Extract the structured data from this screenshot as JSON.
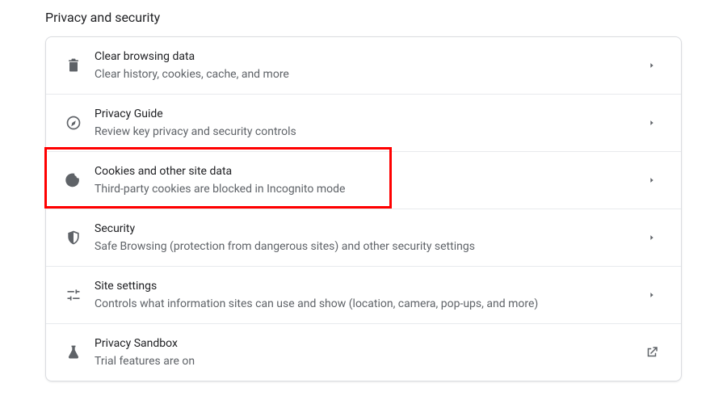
{
  "section_title": "Privacy and security",
  "items": [
    {
      "title": "Clear browsing data",
      "subtitle": "Clear history, cookies, cache, and more",
      "icon": "trash-icon",
      "action": "arrow"
    },
    {
      "title": "Privacy Guide",
      "subtitle": "Review key privacy and security controls",
      "icon": "compass-icon",
      "action": "arrow"
    },
    {
      "title": "Cookies and other site data",
      "subtitle": "Third-party cookies are blocked in Incognito mode",
      "icon": "cookie-icon",
      "action": "arrow"
    },
    {
      "title": "Security",
      "subtitle": "Safe Browsing (protection from dangerous sites) and other security settings",
      "icon": "shield-icon",
      "action": "arrow"
    },
    {
      "title": "Site settings",
      "subtitle": "Controls what information sites can use and show (location, camera, pop-ups, and more)",
      "icon": "sliders-icon",
      "action": "arrow"
    },
    {
      "title": "Privacy Sandbox",
      "subtitle": "Trial features are on",
      "icon": "flask-icon",
      "action": "external"
    }
  ],
  "highlight_index": 2
}
